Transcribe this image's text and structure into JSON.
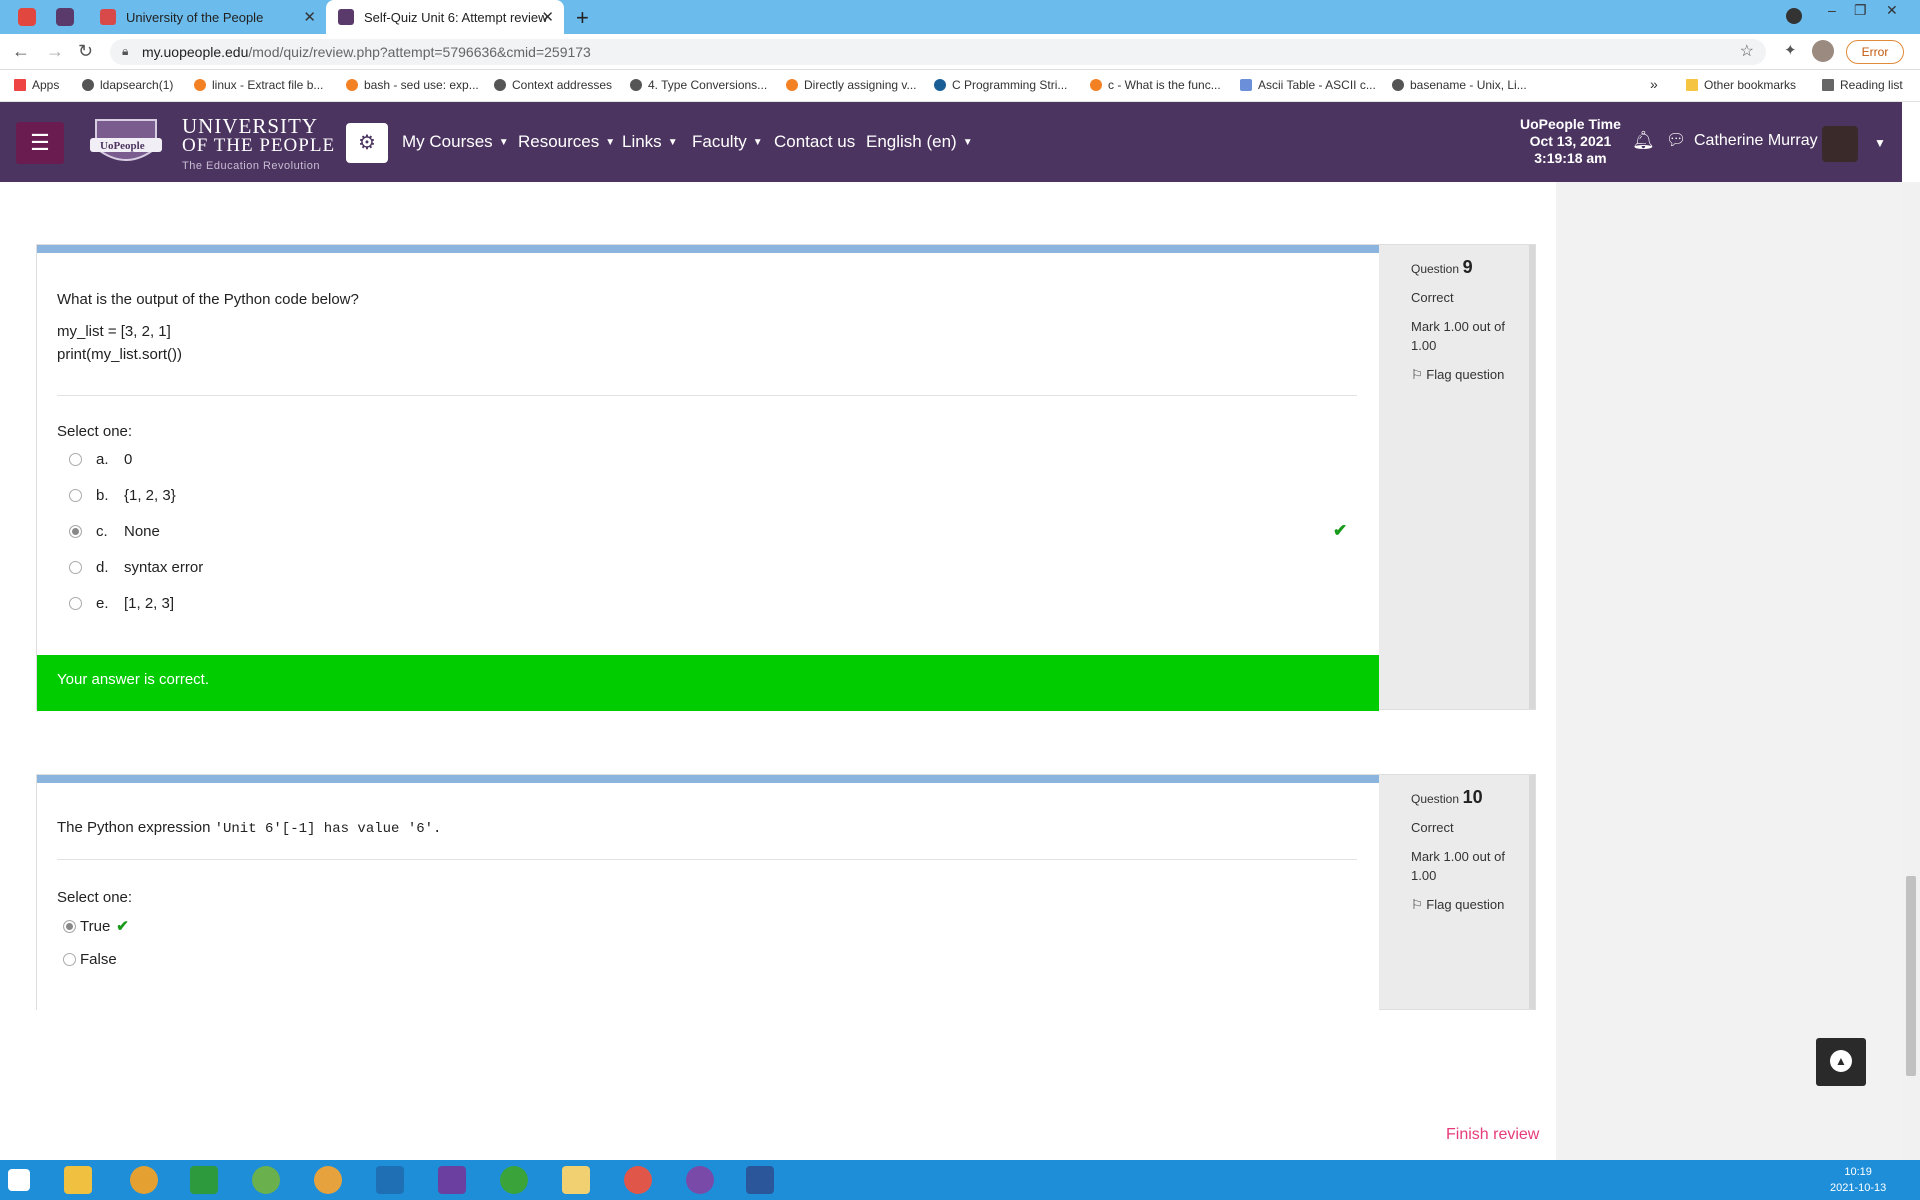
{
  "browser": {
    "tabs": [
      {
        "title": "University of the People",
        "active": false
      },
      {
        "title": "Self-Quiz Unit 6: Attempt review",
        "active": true
      }
    ],
    "url_host": "my.uopeople.edu",
    "url_path": "/mod/quiz/review.php?attempt=5796636&cmid=259173",
    "error_label": "Error",
    "bookmarks": [
      "Apps",
      "ldapsearch(1)",
      "linux - Extract file b...",
      "bash - sed use: exp...",
      "Context addresses",
      "4. Type Conversions...",
      "Directly assigning v...",
      "C Programming Stri...",
      "c - What is the func...",
      "Ascii Table - ASCII c...",
      "basename - Unix, Li..."
    ],
    "bookmarks_more": "»",
    "other_bookmarks": "Other bookmarks",
    "reading_list": "Reading list"
  },
  "site": {
    "logo_text": "UoPeople",
    "name_line1": "UNIVERSITY",
    "name_line2": "OF THE PEOPLE",
    "tagline": "The Education Revolution",
    "menu": [
      "My Courses",
      "Resources",
      "Links",
      "Faculty",
      "Contact us",
      "English (en)"
    ],
    "time_label": "UoPeople Time",
    "time_date": "Oct 13, 2021",
    "time_clock": "3:19:18 am",
    "user_name": "Catherine Murray"
  },
  "questions": [
    {
      "number_label": "Question",
      "number": "9",
      "status": "Correct",
      "mark": "Mark 1.00 out of 1.00",
      "flag": "Flag question",
      "text": "What is the output of the Python code below?",
      "code": [
        "my_list = [3, 2, 1]",
        "print(my_list.sort())"
      ],
      "select_label": "Select one:",
      "options": [
        {
          "letter": "a.",
          "text": "0"
        },
        {
          "letter": "b.",
          "text": "{1, 2, 3}"
        },
        {
          "letter": "c.",
          "text": "None"
        },
        {
          "letter": "d.",
          "text": "syntax error"
        },
        {
          "letter": "e.",
          "text": "[1, 2, 3]"
        }
      ],
      "selected_index": 2,
      "feedback": "Your answer is correct."
    },
    {
      "number_label": "Question",
      "number": "10",
      "status": "Correct",
      "mark": "Mark 1.00 out of 1.00",
      "flag": "Flag question",
      "text_prefix": "The Python expression ",
      "text_code": "'Unit 6'[-1] has value '6'.",
      "select_label": "Select one:",
      "options": [
        {
          "text": "True"
        },
        {
          "text": "False"
        }
      ],
      "selected_index": 0
    }
  ],
  "finish_review": "Finish review",
  "taskbar": {
    "time": "10:19",
    "date": "2021-10-13"
  },
  "colors": {
    "nav_bg": "#4c3460",
    "correct_green": "#00cc00",
    "finish_link": "#e63a7a"
  }
}
